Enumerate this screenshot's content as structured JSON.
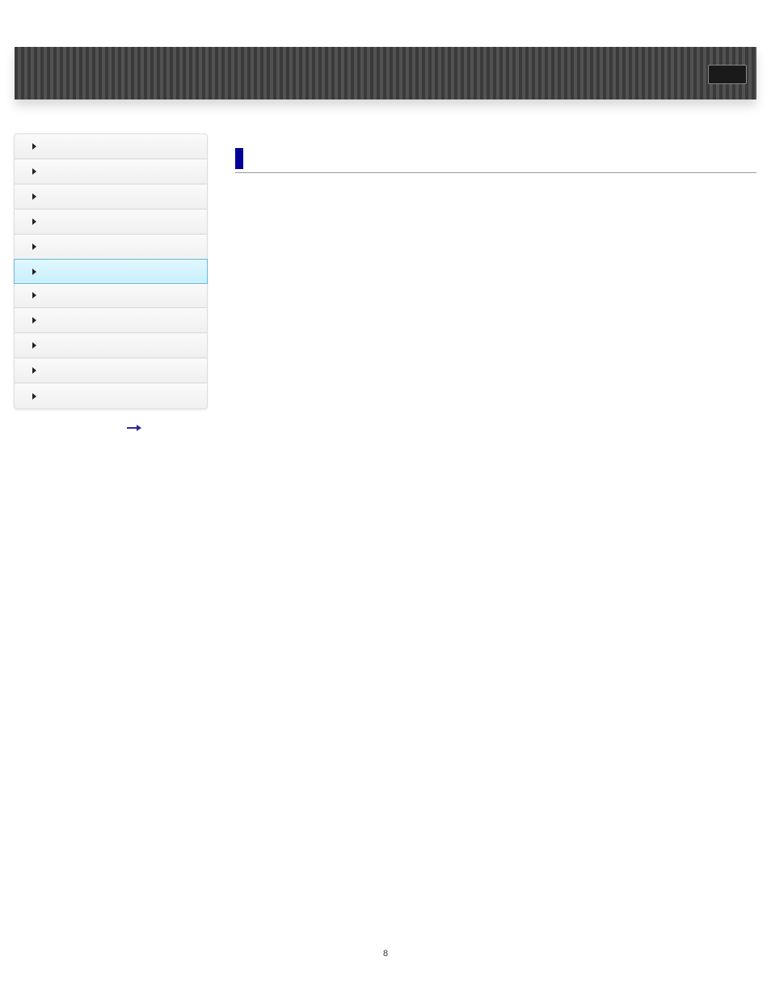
{
  "sidebar": {
    "items": [
      {
        "label": ""
      },
      {
        "label": ""
      },
      {
        "label": ""
      },
      {
        "label": ""
      },
      {
        "label": ""
      },
      {
        "label": ""
      },
      {
        "label": ""
      },
      {
        "label": ""
      },
      {
        "label": ""
      },
      {
        "label": ""
      },
      {
        "label": ""
      }
    ],
    "activeIndex": 5
  },
  "page": {
    "number": "8"
  }
}
